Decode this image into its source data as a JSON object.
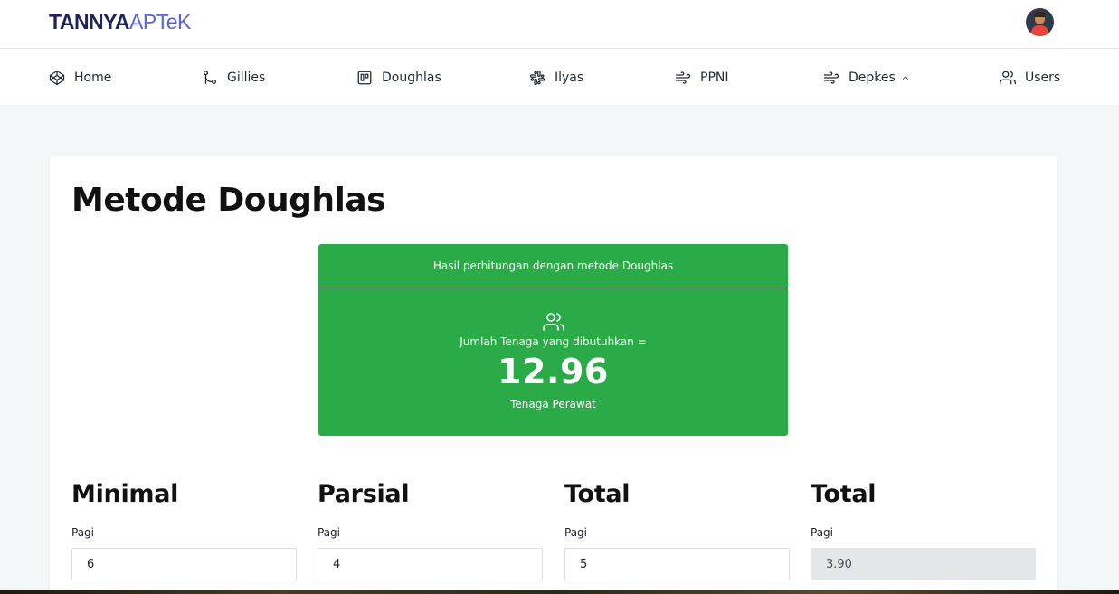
{
  "brand": {
    "part1": "TANNYA",
    "part2": "APTeK"
  },
  "nav": {
    "items": [
      {
        "label": "Home",
        "icon": "codepen-icon"
      },
      {
        "label": "Gillies",
        "icon": "git-branch-icon"
      },
      {
        "label": "Doughlas",
        "icon": "trello-icon"
      },
      {
        "label": "Ilyas",
        "icon": "slack-icon"
      },
      {
        "label": "PPNI",
        "icon": "wind-icon"
      },
      {
        "label": "Depkes",
        "icon": "wind-icon"
      },
      {
        "label": "Users",
        "icon": "users-icon"
      }
    ]
  },
  "page": {
    "title": "Metode Doughlas"
  },
  "result": {
    "header": "Hasil perhitungan dengan metode Doughlas",
    "label": "Jumlah Tenaga yang dibutuhkan =",
    "value": "12.96",
    "unit": "Tenaga Perawat"
  },
  "columns": [
    {
      "title": "Minimal",
      "field_label": "Pagi",
      "value": "6"
    },
    {
      "title": "Parsial",
      "field_label": "Pagi",
      "value": "4"
    },
    {
      "title": "Total",
      "field_label": "Pagi",
      "value": "5"
    },
    {
      "title": "Total",
      "field_label": "Pagi",
      "value": "3.90"
    }
  ],
  "colors": {
    "accent": "#2bab48",
    "brand_dark": "#1e2458",
    "brand_light": "#5b63d8"
  }
}
